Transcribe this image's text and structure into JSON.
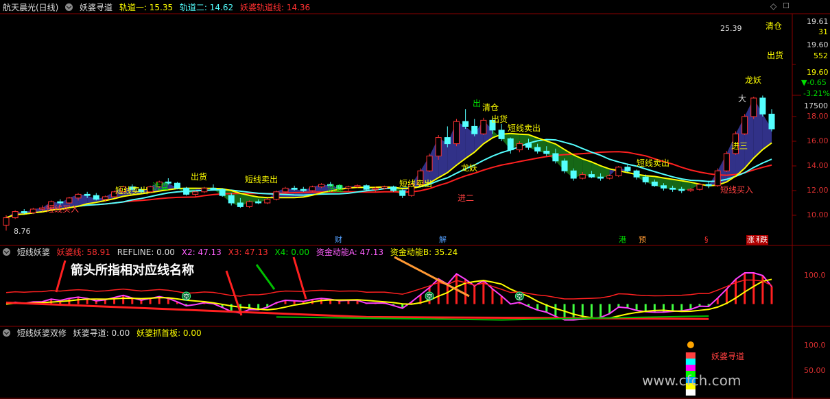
{
  "main_header": {
    "stock": "航天晨光(日线)",
    "indicator": "妖婆寻道",
    "track1_label": "轨道一: ",
    "track1_value": "15.35",
    "track2_label": "轨道二: ",
    "track2_value": "14.62",
    "track3_label": "妖婆轨道线: ",
    "track3_value": "14.36"
  },
  "right_axis": {
    "price_ticks": [
      "18.00",
      "16.00",
      "14.00",
      "12.00",
      "10.00"
    ],
    "quote": {
      "high": "19.61",
      "n1": "31",
      "mid": "19.60",
      "n2": "552",
      "last": "19.60",
      "change": "▼-0.65",
      "pct": "-3.21%",
      "vol": "17500"
    },
    "sub1_tick": "100.0",
    "sub2_ticks": [
      "100.0",
      "50.00"
    ]
  },
  "annotations": {
    "high_label": "25.39",
    "low_label": "8.76",
    "qingcang_top": "清仓",
    "chuhuo_top": "出货",
    "longyao": "龙妖",
    "jin3": "进三",
    "da": "大",
    "chu_mid": "出",
    "qingcang_mid": "清仓",
    "chuhuo_mid": "出货",
    "duanxian_mc1": "短线卖出",
    "duanxian_mc2": "短线卖出",
    "duanxian_mc3": "短线卖出",
    "duanxian_mc4": "短线卖出",
    "duanxian_mc5": "短线卖出",
    "chuhuo_left": "出货",
    "longyao_mid": "龙妖",
    "jin2": "进二",
    "duanxian_mr1": "短线买入",
    "duanxian_mr2": "短线买入",
    "xipan1": "洗盘",
    "xipan2": "洗盘"
  },
  "event_badges": [
    "财",
    "解",
    "港",
    "预",
    "§",
    "涨",
    "利",
    "跌"
  ],
  "sub1_header": {
    "name": "短线妖婆",
    "l1": "妖婆线: 58.91",
    "l2": "REFLINE: 0.00",
    "l3": "X2: 47.13",
    "l4": "X3: 47.13",
    "l5": "X4: 0.00",
    "l6": "资金动能A: 47.13",
    "l7": "资金动能B: 35.24"
  },
  "sub1_note": "箭头所指相对应线名称",
  "sub1_marks": [
    "空",
    "空",
    "空"
  ],
  "sub2_header": {
    "name": "短线妖婆双修",
    "l1": "妖婆寻道: 0.00",
    "l2": "妖婆抓首板: 0.00"
  },
  "sub2_label": "妖婆寻道",
  "watermark": "www.cfch.com",
  "colors": {
    "up": "#ff3232",
    "down": "#54ffff",
    "track1": "#ffff00",
    "track2": "#54ffff",
    "track3": "#ff2020",
    "band_up": "#3a3aa0",
    "band_down": "#1a7a1a"
  },
  "chart_data": {
    "type": "candlestick",
    "ylim": [
      9.0,
      20.2
    ],
    "y_ticks": [
      10,
      12,
      14,
      16,
      18
    ],
    "ohlc": [
      [
        9.2,
        10.0,
        8.76,
        9.8
      ],
      [
        9.8,
        10.4,
        9.7,
        10.3
      ],
      [
        10.3,
        10.5,
        10.1,
        10.2
      ],
      [
        10.2,
        10.6,
        10.1,
        10.5
      ],
      [
        10.5,
        10.8,
        10.3,
        10.6
      ],
      [
        10.6,
        11.2,
        10.5,
        11.1
      ],
      [
        11.1,
        11.3,
        10.8,
        11.0
      ],
      [
        11.0,
        11.5,
        10.9,
        11.4
      ],
      [
        11.4,
        11.8,
        11.2,
        11.7
      ],
      [
        11.7,
        11.9,
        11.4,
        11.6
      ],
      [
        11.6,
        11.8,
        11.2,
        11.3
      ],
      [
        11.3,
        11.6,
        11.1,
        11.5
      ],
      [
        11.5,
        12.0,
        11.4,
        11.9
      ],
      [
        11.9,
        12.4,
        11.8,
        12.3
      ],
      [
        12.3,
        12.5,
        12.0,
        12.1
      ],
      [
        12.1,
        12.3,
        11.8,
        11.9
      ],
      [
        11.9,
        12.4,
        11.8,
        12.3
      ],
      [
        12.3,
        12.8,
        12.2,
        12.7
      ],
      [
        12.7,
        13.0,
        12.5,
        12.6
      ],
      [
        12.6,
        12.7,
        12.1,
        12.2
      ],
      [
        12.2,
        12.3,
        11.6,
        11.7
      ],
      [
        11.7,
        12.0,
        11.5,
        11.9
      ],
      [
        11.9,
        12.3,
        11.8,
        12.2
      ],
      [
        12.2,
        12.5,
        12.0,
        12.1
      ],
      [
        12.1,
        12.2,
        11.5,
        11.6
      ],
      [
        11.6,
        11.8,
        10.8,
        11.0
      ],
      [
        11.0,
        11.4,
        10.6,
        10.7
      ],
      [
        10.7,
        11.2,
        10.6,
        11.1
      ],
      [
        11.1,
        11.3,
        10.9,
        11.0
      ],
      [
        11.0,
        11.4,
        10.9,
        11.3
      ],
      [
        11.3,
        12.0,
        11.2,
        11.9
      ],
      [
        11.9,
        12.3,
        11.8,
        12.2
      ],
      [
        12.2,
        12.4,
        12.0,
        12.1
      ],
      [
        12.1,
        12.3,
        11.9,
        12.0
      ],
      [
        12.0,
        12.4,
        11.9,
        12.3
      ],
      [
        12.3,
        12.6,
        12.2,
        12.5
      ],
      [
        12.5,
        12.7,
        12.3,
        12.4
      ],
      [
        12.4,
        12.5,
        12.1,
        12.2
      ],
      [
        12.2,
        12.4,
        12.0,
        12.3
      ],
      [
        12.3,
        12.5,
        12.2,
        12.4
      ],
      [
        12.4,
        12.5,
        12.0,
        12.1
      ],
      [
        12.1,
        12.3,
        11.9,
        12.2
      ],
      [
        12.2,
        12.4,
        12.1,
        12.3
      ],
      [
        12.3,
        12.4,
        11.9,
        12.0
      ],
      [
        12.0,
        12.1,
        11.4,
        11.6
      ],
      [
        11.6,
        12.6,
        11.5,
        12.5
      ],
      [
        12.5,
        13.8,
        12.4,
        13.6
      ],
      [
        13.6,
        15.0,
        13.5,
        14.8
      ],
      [
        14.8,
        16.5,
        14.5,
        16.3
      ],
      [
        16.3,
        17.2,
        15.5,
        15.8
      ],
      [
        15.8,
        17.8,
        15.6,
        17.6
      ],
      [
        17.6,
        18.6,
        17.0,
        17.2
      ],
      [
        17.2,
        17.8,
        16.4,
        16.6
      ],
      [
        16.6,
        17.9,
        16.5,
        17.7
      ],
      [
        17.7,
        17.9,
        16.6,
        16.9
      ],
      [
        16.9,
        17.4,
        16.0,
        16.2
      ],
      [
        16.2,
        16.3,
        15.0,
        15.3
      ],
      [
        15.3,
        16.0,
        15.1,
        15.8
      ],
      [
        15.8,
        16.2,
        15.3,
        15.5
      ],
      [
        15.5,
        15.8,
        15.0,
        15.2
      ],
      [
        15.2,
        15.6,
        14.8,
        15.0
      ],
      [
        15.0,
        15.4,
        14.2,
        14.4
      ],
      [
        14.4,
        14.6,
        13.4,
        13.6
      ],
      [
        13.6,
        13.8,
        12.8,
        13.0
      ],
      [
        13.0,
        13.5,
        12.9,
        13.3
      ],
      [
        13.3,
        13.6,
        13.0,
        13.1
      ],
      [
        13.1,
        13.4,
        12.8,
        13.0
      ],
      [
        13.0,
        13.3,
        12.9,
        13.2
      ],
      [
        13.2,
        14.0,
        13.1,
        13.9
      ],
      [
        13.9,
        14.2,
        13.5,
        13.6
      ],
      [
        13.6,
        13.7,
        12.9,
        13.1
      ],
      [
        13.1,
        13.3,
        12.5,
        12.7
      ],
      [
        12.7,
        12.9,
        12.3,
        12.4
      ],
      [
        12.4,
        12.6,
        12.0,
        12.2
      ],
      [
        12.2,
        12.4,
        11.9,
        12.1
      ],
      [
        12.1,
        12.3,
        11.8,
        12.0
      ],
      [
        12.0,
        12.2,
        11.9,
        12.1
      ],
      [
        12.1,
        12.6,
        12.0,
        12.5
      ],
      [
        12.5,
        12.8,
        12.2,
        12.4
      ],
      [
        12.4,
        13.8,
        12.3,
        13.6
      ],
      [
        13.6,
        15.2,
        13.5,
        15.0
      ],
      [
        15.0,
        16.8,
        14.9,
        16.6
      ],
      [
        16.6,
        18.2,
        16.5,
        18.0
      ],
      [
        18.0,
        19.61,
        17.8,
        19.5
      ],
      [
        19.5,
        19.7,
        18.0,
        18.2
      ],
      [
        18.2,
        18.6,
        16.8,
        17.0
      ]
    ]
  }
}
